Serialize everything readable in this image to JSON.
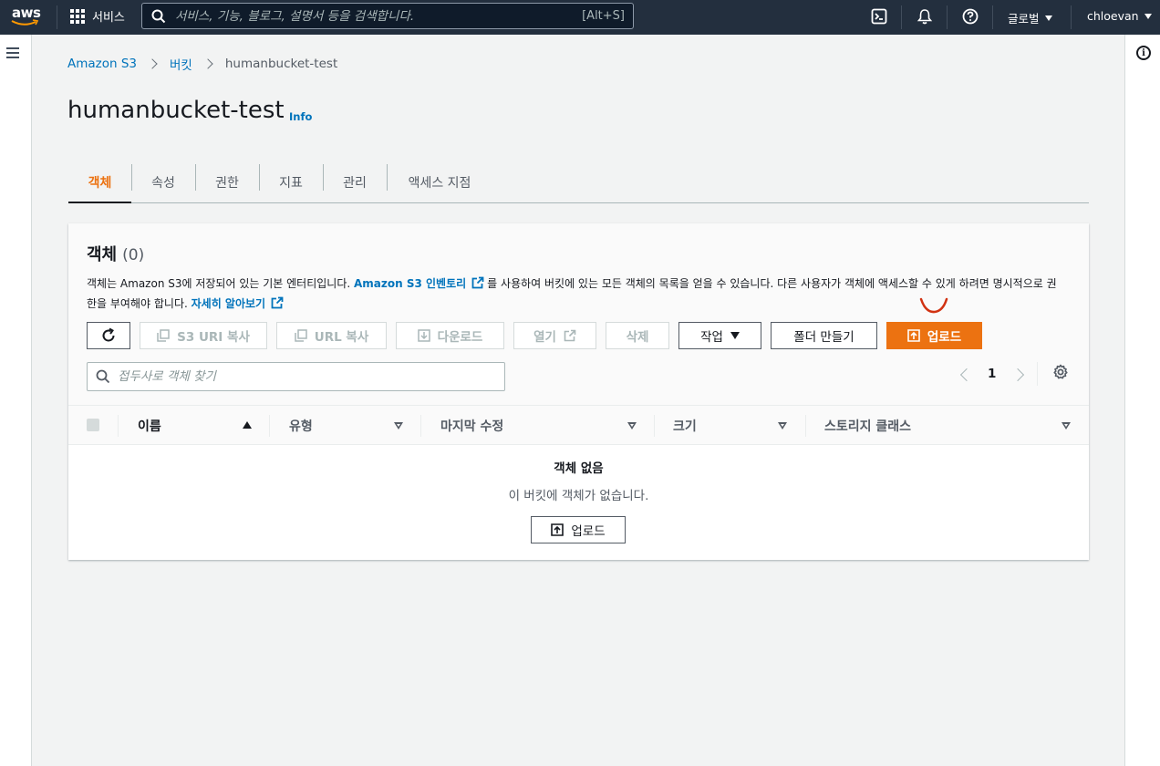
{
  "nav": {
    "logo": "aws",
    "services_label": "서비스",
    "search_placeholder": "서비스, 기능, 블로그, 설명서 등을 검색합니다.",
    "search_shortcut": "[Alt+S]",
    "region_label": "글로벌",
    "user_label": "chloevan",
    "icons": [
      "cloudshell-icon",
      "bell-icon",
      "help-icon"
    ]
  },
  "breadcrumb": {
    "items": [
      "Amazon S3",
      "버킷",
      "humanbucket-test"
    ]
  },
  "page": {
    "title": "humanbucket-test",
    "info_label": "Info"
  },
  "tabs": [
    {
      "label": "객체",
      "active": true
    },
    {
      "label": "속성",
      "active": false
    },
    {
      "label": "권한",
      "active": false
    },
    {
      "label": "지표",
      "active": false
    },
    {
      "label": "관리",
      "active": false
    },
    {
      "label": "액세스 지점",
      "active": false
    }
  ],
  "objects": {
    "title": "객체",
    "count": "(0)",
    "desc_part1": "객체는 Amazon S3에 저장되어 있는 기본 엔터티입니다. ",
    "desc_link1": "Amazon S3 인벤토리",
    "desc_part2": "를 사용하여 버킷에 있는 모든 객체의 목록을 얻을 수 있습니다. 다른 사용자가 객체에 액세스할 수 있게 하려면 명시적으로 권한을 부여해야 합니다. ",
    "desc_link2": "자세히 알아보기",
    "actions": {
      "copy_s3_uri": "S3 URI 복사",
      "copy_url": "URL 복사",
      "download": "다운로드",
      "open": "열기",
      "delete": "삭제",
      "actions": "작업",
      "create_folder": "폴더 만들기",
      "upload": "업로드"
    },
    "filter_placeholder": "접두사로 객체 찾기",
    "page_number": "1",
    "columns": [
      "이름",
      "유형",
      "마지막 수정",
      "크기",
      "스토리지 클래스"
    ],
    "rows": [],
    "empty_title": "객체 없음",
    "empty_desc": "이 버킷에 객체가 없습니다.",
    "empty_upload": "업로드"
  },
  "colors": {
    "nav_bg": "#232f3e",
    "accent": "#ec7211",
    "link": "#0073bb",
    "annotation": "#d13212"
  }
}
